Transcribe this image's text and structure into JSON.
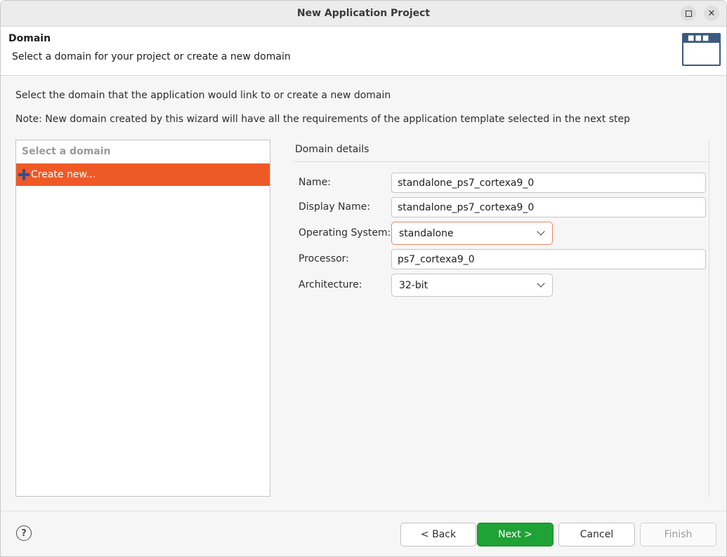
{
  "window": {
    "title": "New Application Project"
  },
  "header": {
    "title": "Domain",
    "description": "Select a domain for your project or create a new domain",
    "icon": "window-banner-icon"
  },
  "body": {
    "intro": "Select the domain that the application would link to or create a new domain",
    "note": "Note: New domain created by this wizard will have all the requirements of the application template selected in the next step"
  },
  "domain_list": {
    "heading": "Select a domain",
    "items": [
      {
        "label": "Create new...",
        "icon": "plus-icon",
        "selected": true
      }
    ],
    "selected_color": "#ee5a26"
  },
  "details": {
    "title": "Domain details",
    "name_label": "Name:",
    "name_value": "standalone_ps7_cortexa9_0",
    "display_name_label": "Display Name:",
    "display_name_value": "standalone_ps7_cortexa9_0",
    "os_label": "Operating System:",
    "os_value": "standalone",
    "processor_label": "Processor:",
    "processor_value": "ps7_cortexa9_0",
    "arch_label": "Architecture:",
    "arch_value": "32-bit"
  },
  "footer": {
    "help_icon": "help-icon",
    "back_label": "< Back",
    "next_label": "Next >",
    "cancel_label": "Cancel",
    "finish_label": "Finish",
    "next_color": "#1fa334"
  }
}
